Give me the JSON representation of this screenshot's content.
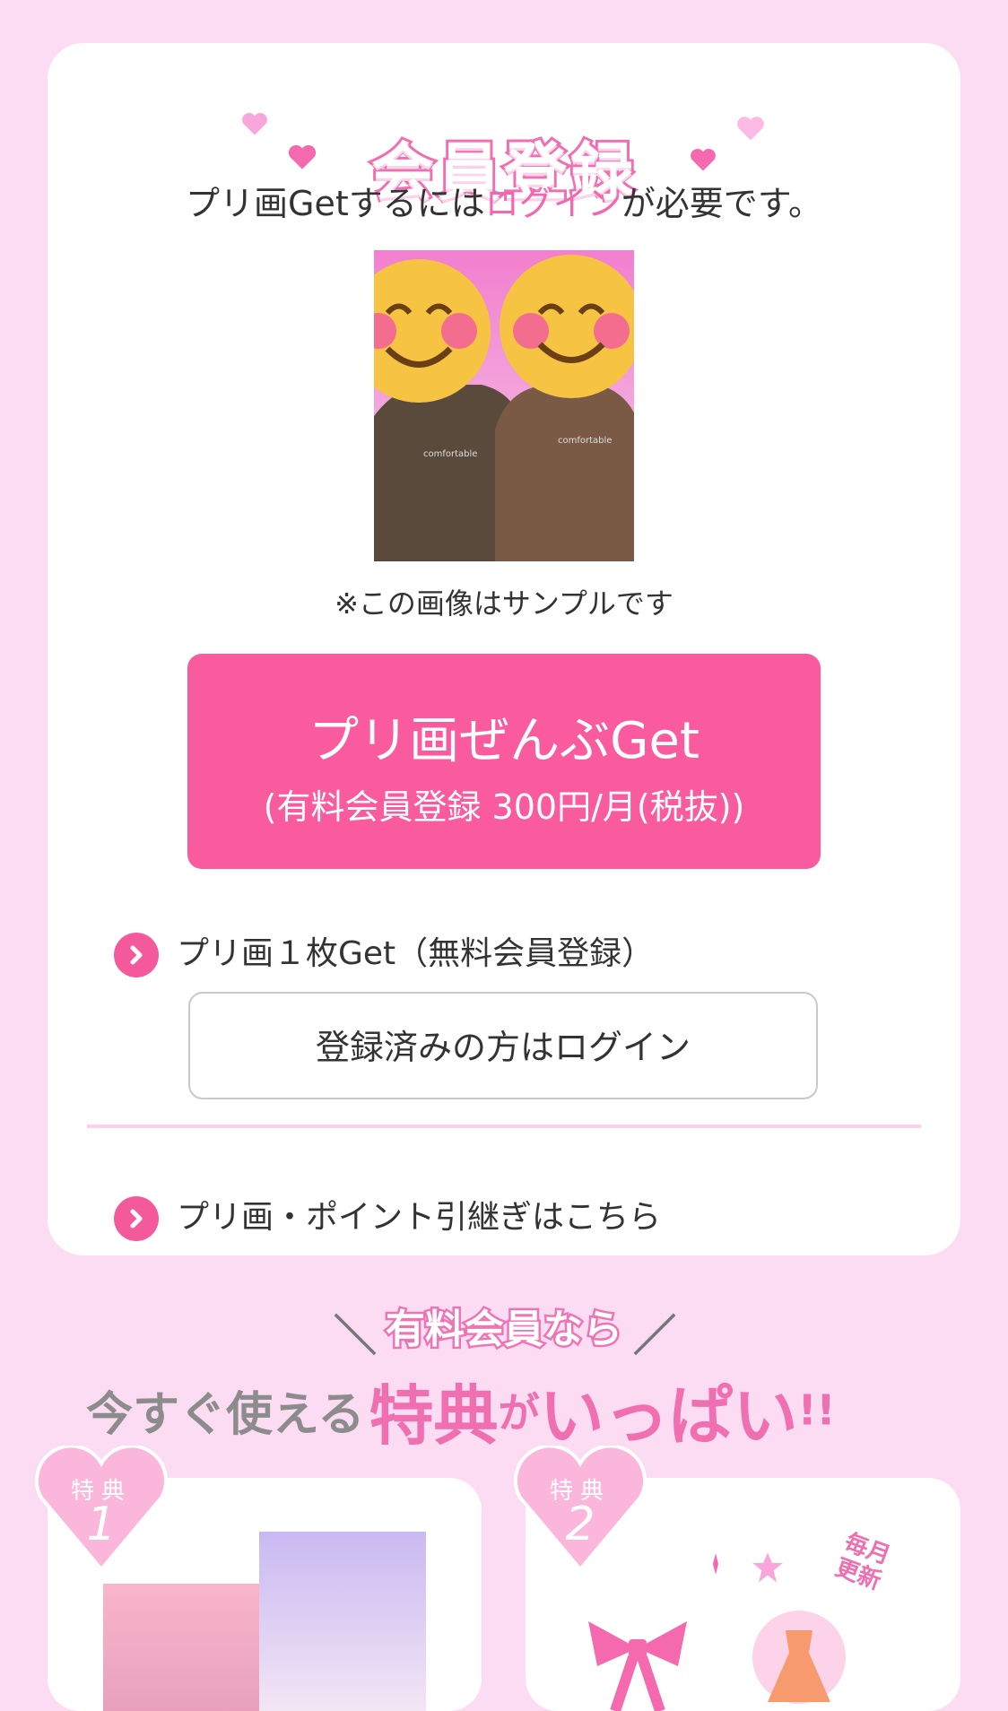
{
  "colors": {
    "page_bg": "#fbdcf3",
    "accent": "#fa5b9e",
    "title_pink": "#f06fb1",
    "card_bg": "#ffffff"
  },
  "register": {
    "title": "会員登録",
    "lead_prefix": "プリ画Getするには",
    "lead_link": "ログイン",
    "lead_suffix": "が必要です。",
    "sample_note": "※この画像はサンプルです",
    "get_all_line1": "プリ画ぜんぶGet",
    "get_all_line2": "(有料会員登録 300円/月(税抜))",
    "get_one_label": "プリ画１枚Get（無料会員登録）",
    "login_button": "登録済みの方はログイン",
    "transfer_label": "プリ画・ポイント引継ぎはこちら"
  },
  "promo": {
    "subtitle": "有料会員なら",
    "main_gray": "今すぐ使える",
    "main_pink_big": "特典",
    "main_pink_small": "が",
    "main_pink_big2": "いっぱい",
    "main_excl": "!!"
  },
  "benefits": [
    {
      "badge_label": "特典",
      "badge_number": "1"
    },
    {
      "badge_label": "特典",
      "badge_number": "2",
      "tag_line1": "毎月",
      "tag_line2": "更新"
    }
  ]
}
